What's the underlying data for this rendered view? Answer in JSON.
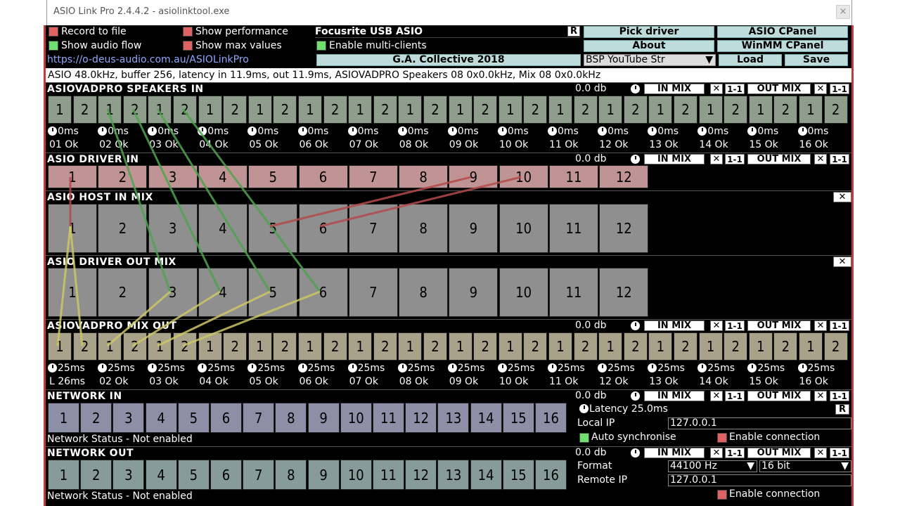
{
  "window": {
    "title": "ASIO Link Pro 2.4.4.2 - asiolinktool.exe",
    "close": "×"
  },
  "top": {
    "record_to_file": "Record to file",
    "show_audio_flow": "Show audio flow",
    "show_performance": "Show performance",
    "show_max_values": "Show max values",
    "driver_name": "Focusrite USB ASIO",
    "r_button": "R",
    "enable_multi_clients": "Enable multi-clients",
    "pick_driver": "Pick driver",
    "asio_cpanel": "ASIO CPanel",
    "about": "About",
    "winmm_cpanel": "WinMM CPanel",
    "link": "https://o-deus-audio.com.au/ASIOLinkPro",
    "preset": "G.A. Collective 2018",
    "preset_select": "BSP YouTube Str",
    "load": "Load",
    "save": "Save",
    "status": "ASIO 48.0kHz, buffer 256, latency in 11.9ms, out 11.9ms, ASIOVADPRO Speakers 08 0x0.0kHz, Mix 08 0x0.0kHz"
  },
  "strip": {
    "db": "0.0 db",
    "in_mix": "IN MIX",
    "out_mix": "OUT MIX",
    "x": "✕",
    "one_to_one": "1-1"
  },
  "sections": {
    "speakers_in": {
      "title": "ASIOVADPRO SPEAKERS IN",
      "channels": [
        "1",
        "2",
        "1",
        "2",
        "1",
        "2",
        "1",
        "2",
        "1",
        "2",
        "1",
        "2",
        "1",
        "2",
        "1",
        "2",
        "1",
        "2",
        "1",
        "2",
        "1",
        "2",
        "1",
        "2",
        "1",
        "2",
        "1",
        "2",
        "1",
        "2",
        "1",
        "2"
      ],
      "times": [
        "0ms",
        "0ms",
        "0ms",
        "0ms",
        "0ms",
        "0ms",
        "0ms",
        "0ms",
        "0ms",
        "0ms",
        "0ms",
        "0ms",
        "0ms",
        "0ms",
        "0ms",
        "0ms"
      ],
      "status": [
        "01 Ok",
        "02 Ok",
        "03 Ok",
        "04 Ok",
        "05 Ok",
        "06 Ok",
        "07 Ok",
        "08 Ok",
        "09 Ok",
        "10 Ok",
        "11 Ok",
        "12 Ok",
        "13 Ok",
        "14 Ok",
        "15 Ok",
        "16 Ok"
      ]
    },
    "driver_in": {
      "title": "ASIO DRIVER IN",
      "channels": [
        "1",
        "2",
        "3",
        "4",
        "5",
        "6",
        "7",
        "8",
        "9",
        "10",
        "11",
        "12"
      ]
    },
    "host_in_mix": {
      "title": "ASIO HOST IN MIX",
      "channels": [
        "1",
        "2",
        "3",
        "4",
        "5",
        "6",
        "7",
        "8",
        "9",
        "10",
        "11",
        "12"
      ]
    },
    "driver_out_mix": {
      "title": "ASIO DRIVER OUT MIX",
      "channels": [
        "1",
        "2",
        "3",
        "4",
        "5",
        "6",
        "7",
        "8",
        "9",
        "10",
        "11",
        "12"
      ]
    },
    "mix_out": {
      "title": "ASIOVADPRO MIX OUT",
      "channels": [
        "1",
        "2",
        "1",
        "2",
        "1",
        "2",
        "1",
        "2",
        "1",
        "2",
        "1",
        "2",
        "1",
        "2",
        "1",
        "2",
        "1",
        "2",
        "1",
        "2",
        "1",
        "2",
        "1",
        "2",
        "1",
        "2",
        "1",
        "2",
        "1",
        "2",
        "1",
        "2"
      ],
      "times": [
        "25ms",
        "25ms",
        "25ms",
        "25ms",
        "25ms",
        "25ms",
        "25ms",
        "25ms",
        "25ms",
        "25ms",
        "25ms",
        "25ms",
        "25ms",
        "25ms",
        "25ms",
        "25ms"
      ],
      "status": [
        "L 26ms",
        "02 Ok",
        "03 Ok",
        "04 Ok",
        "05 Ok",
        "06 Ok",
        "07 Ok",
        "08 Ok",
        "09 Ok",
        "10 Ok",
        "11 Ok",
        "12 Ok",
        "13 Ok",
        "14 Ok",
        "15 Ok",
        "16 Ok"
      ]
    },
    "network_in": {
      "title": "NETWORK IN",
      "channels": [
        "1",
        "2",
        "3",
        "4",
        "5",
        "6",
        "7",
        "8",
        "9",
        "10",
        "11",
        "12",
        "13",
        "14",
        "15",
        "16"
      ],
      "status": "Network Status - Not enabled",
      "latency": "Latency 25.0ms",
      "local_ip_label": "Local IP",
      "local_ip": "127.0.0.1",
      "auto_sync": "Auto synchronise",
      "enable_connection": "Enable connection"
    },
    "network_out": {
      "title": "NETWORK OUT",
      "channels": [
        "1",
        "2",
        "3",
        "4",
        "5",
        "6",
        "7",
        "8",
        "9",
        "10",
        "11",
        "12",
        "13",
        "14",
        "15",
        "16"
      ],
      "status": "Network Status - Not enabled",
      "format_label": "Format",
      "format_rate": "44100 Hz",
      "format_bits": "16 bit",
      "remote_ip_label": "Remote IP",
      "remote_ip": "127.0.0.1",
      "enable_connection": "Enable connection"
    }
  },
  "colors": {
    "speakers": "#8f9e8c",
    "driver_in": "#c09494",
    "host": "#8f8f8f",
    "mix_out": "#a9a28a",
    "net_in": "#8c8fa6",
    "net_out": "#879c9a",
    "route_green": "#4fa34f",
    "route_yellow": "#cdc765",
    "route_red": "#b34a4a"
  }
}
